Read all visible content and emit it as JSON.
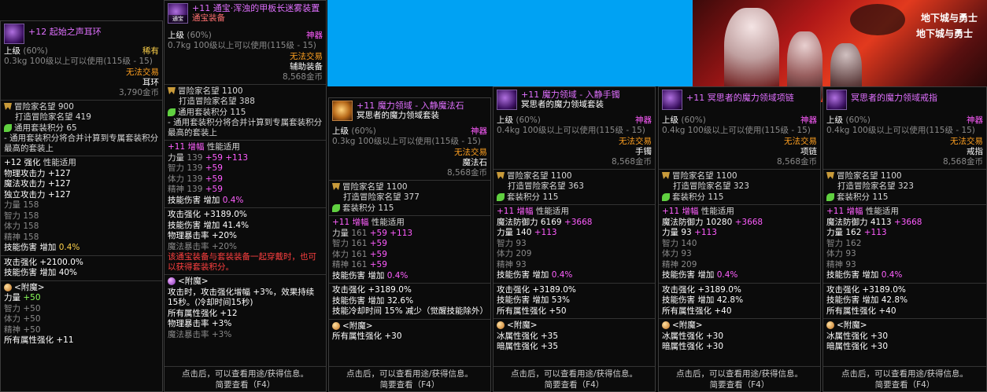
{
  "common": {
    "grade_upper": "上级",
    "level_req": "100级以上可以使用(115级 - 15)",
    "no_trade": "无法交易",
    "adv_fame": "冒险家名望",
    "craft_fame": "打造冒险家名望",
    "set_points": "套装积分",
    "set_points_alt": "通用套装积分",
    "amp_label": "增幅",
    "attr_apply": "性能适用",
    "str": "力量",
    "int": "智力",
    "vit": "体力",
    "spi": "精神",
    "skill_dmg": "技能伤害",
    "increase": "增加",
    "atk_up": "攻击强化",
    "enchant": "<附魔>",
    "all_elem": "所有属性强化",
    "footer1": "点击后，可以查看用途/获得信息。",
    "footer2": "简要查看（F4）",
    "gold_unit": "金币"
  },
  "p1": {
    "title": "+12 起始之声耳环",
    "pct": "(60%)",
    "rarity": "稀有",
    "weight": "0.3kg",
    "slot": "耳环",
    "price": "3,790",
    "fame": "900",
    "craft": "419",
    "setpts": "65",
    "note": "- 通用套装积分将合并计算到专属套装积分最高的套装上",
    "enh": "+12 强化",
    "patk": "物理攻击力",
    "patk_v": "+127",
    "matk": "魔法攻击力",
    "matk_v": "+127",
    "iatk": "独立攻击力",
    "iatk_v": "+127",
    "str_v": "158",
    "int_v": "158",
    "vit_v": "158",
    "spi_v": "158",
    "skill_v": "0.4%",
    "atk_v": "+2100.0%",
    "skill2_v": "40%",
    "ench_str": "+50",
    "ench_int": "+50",
    "ench_vit": "+50",
    "ench_spi": "+50",
    "ench_all": "+11"
  },
  "p2": {
    "title": "+11 通宝·浑浊的甲板长迷雾装置",
    "subtitle": "通宝装备",
    "icon_tag": "通宝",
    "pct": "(60%)",
    "rarity": "神器",
    "weight": "0.7kg",
    "slot": "辅助装备",
    "price": "8,568",
    "fame": "1100",
    "craft": "388",
    "setpts": "115",
    "note": "- 通用套装积分将合并计算到专属套装积分最高的套装上",
    "amp": "+11 增幅",
    "str_v": "139",
    "str_a": "+59",
    "str_b": "+113",
    "int_v": "139",
    "int_a": "+59",
    "vit_v": "139",
    "vit_a": "+59",
    "spi_v": "139",
    "spi_a": "+59",
    "skill_v": "0.4%",
    "atk_v": "+3189.0%",
    "skill2_v": "41.4%",
    "pcrit": "物理暴击率",
    "pcrit_v": "+20%",
    "mcrit": "魔法暴击率",
    "mcrit_v": "+20%",
    "warn": "该通宝装备与套装装备一起穿戴时，也可以获得套装积分。",
    "ench_note": "攻击时，攻击强化增幅 +3%，效果持续15秒。(冷却时间15秒)",
    "ench_all": "+12",
    "ench_pcrit_v": "+3%",
    "ench_mcrit_v": "+3%"
  },
  "p3": {
    "title": "+11 魔力领域 - 入静魔法石",
    "subtitle": "冥思者的魔力领域套装",
    "pct": "(60%)",
    "rarity": "神器",
    "weight": "0.3kg",
    "slot": "魔法石",
    "price": "8,568",
    "fame": "1100",
    "craft": "377",
    "setpts": "115",
    "amp": "+11 增幅",
    "str_v": "161",
    "str_a": "+59",
    "str_b": "+113",
    "int_v": "161",
    "int_a": "+59",
    "vit_v": "161",
    "vit_a": "+59",
    "spi_v": "161",
    "spi_a": "+59",
    "skill_v": "0.4%",
    "atk_v": "+3189.0%",
    "skill2_v": "32.6%",
    "cd": "技能冷却时间 15% 减少（觉醒技能除外）",
    "ench_all": "+30"
  },
  "p4": {
    "title": "+11 魔力领域 - 入静手镯",
    "subtitle": "冥思者的魔力领域套装",
    "pct": "(60%)",
    "rarity": "神器",
    "weight": "0.4kg",
    "slot": "手镯",
    "price": "8,568",
    "fame": "1100",
    "craft": "363",
    "setpts": "115",
    "amp": "+11 增幅",
    "mdef": "魔法防御力",
    "mdef_v": "6169",
    "mdef_b": "+3668",
    "str_v": "140",
    "str_b": "+113",
    "int_v": "93",
    "vit_v": "209",
    "spi_v": "93",
    "skill_v": "0.4%",
    "atk_v": "+3189.0%",
    "skill2_v": "53%",
    "all_v": "+50",
    "ice": "冰属性强化",
    "ice_v": "+35",
    "dark": "暗属性强化",
    "dark_v": "+35"
  },
  "p5": {
    "title": "+11 冥思者的魔力领域项链",
    "pct": "(60%)",
    "rarity": "神器",
    "weight": "0.4kg",
    "slot": "项链",
    "price": "8,568",
    "fame": "1100",
    "craft": "323",
    "setpts": "115",
    "amp": "+11 增幅",
    "mdef": "魔法防御力",
    "mdef_v": "10280",
    "mdef_b": "+3668",
    "str_v": "93",
    "str_b": "+113",
    "int_v": "140",
    "vit_v": "93",
    "spi_v": "209",
    "skill_v": "0.4%",
    "atk_v": "+3189.0%",
    "skill2_v": "42.8%",
    "all_v": "+40",
    "ice": "冰属性强化",
    "ice_v": "+30",
    "dark": "暗属性强化",
    "dark_v": "+30"
  },
  "p6": {
    "title": "冥思者的魔力领域戒指",
    "pct": "(60%)",
    "rarity": "神器",
    "weight": "0.4kg",
    "slot": "戒指",
    "price": "8,568",
    "fame": "1100",
    "craft": "323",
    "setpts": "115",
    "amp": "+11 增幅",
    "mdef": "魔法防御力",
    "mdef_v": "4113",
    "mdef_b": "+3668",
    "str_v": "162",
    "str_b": "+113",
    "int_v": "162",
    "vit_v": "93",
    "spi_v": "93",
    "skill_v": "0.4%",
    "atk_v": "+3189.0%",
    "skill2_v": "42.8%",
    "all_v": "+40",
    "ice": "冰属性强化",
    "ice_v": "+30",
    "dark": "暗属性强化",
    "dark_v": "+30"
  },
  "banner": {
    "logo1": "地下城与勇士",
    "logo2": "地下城与勇士"
  }
}
